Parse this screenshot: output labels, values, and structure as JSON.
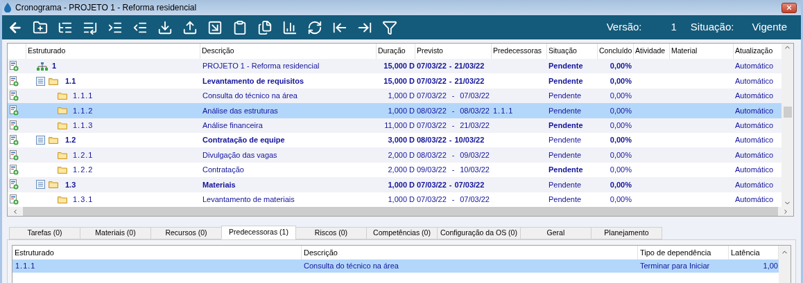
{
  "window": {
    "title": "Cronograma - PROJETO 1 - Reforma residencial"
  },
  "toolbar": {
    "version_label": "Versão:",
    "version": "1",
    "status_label": "Situação:",
    "status": "Vigente"
  },
  "schedule": {
    "columns": [
      "Estruturado",
      "Descrição",
      "Duração",
      "Previsto",
      "Predecessoras",
      "Situação",
      "Concluído",
      "Atividade",
      "Material",
      "Atualização"
    ],
    "rows": [
      {
        "kind": "project",
        "code": "1",
        "description": "PROJETO 1 - Reforma residencial",
        "duration": "15,000 D",
        "start": "07/03/22",
        "separator": "-",
        "end": "21/03/22",
        "status": "Pendente",
        "status_bold": true,
        "done": "0,00%",
        "update": "Automático",
        "selected": false
      },
      {
        "kind": "group",
        "code": "1.1",
        "description": "Levantamento de requisitos",
        "duration": "15,000 D",
        "start": "07/03/22",
        "separator": "-",
        "end": "21/03/22",
        "status": "Pendente",
        "status_bold": true,
        "done": "0,00%",
        "update": "Automático",
        "selected": false
      },
      {
        "kind": "task",
        "code": "1.1.1",
        "description": "Consulta do técnico na área",
        "duration": "1,000 D",
        "start": "07/03/22",
        "separator": "-",
        "end": "07/03/22",
        "status": "Pendente",
        "status_bold": false,
        "done": "0,00%",
        "update": "Automático",
        "selected": false
      },
      {
        "kind": "task",
        "code": "1.1.2",
        "description": "Análise das estruturas",
        "duration": "1,000 D",
        "start": "08/03/22",
        "separator": "-",
        "end": "08/03/22",
        "predecessors": "1.1.1",
        "status": "Pendente",
        "status_bold": false,
        "done": "0,00%",
        "update": "Automático",
        "selected": true
      },
      {
        "kind": "task",
        "code": "1.1.3",
        "description": "Análise financeira",
        "duration": "11,000 D",
        "start": "07/03/22",
        "separator": "-",
        "end": "21/03/22",
        "status": "Pendente",
        "status_bold": true,
        "done": "0,00%",
        "update": "Automático",
        "selected": false
      },
      {
        "kind": "group",
        "code": "1.2",
        "description": "Contratação de equipe",
        "duration": "3,000 D",
        "start": "08/03/22",
        "separator": "-",
        "end": "10/03/22",
        "status": "Pendente",
        "status_bold": false,
        "done": "0,00%",
        "update": "Automático",
        "selected": false
      },
      {
        "kind": "task",
        "code": "1.2.1",
        "description": "Divulgação das vagas",
        "duration": "2,000 D",
        "start": "08/03/22",
        "separator": "-",
        "end": "09/03/22",
        "status": "Pendente",
        "status_bold": false,
        "done": "0,00%",
        "update": "Automático",
        "selected": false
      },
      {
        "kind": "task",
        "code": "1.2.2",
        "description": "Contratação",
        "duration": "2,000 D",
        "start": "09/03/22",
        "separator": "-",
        "end": "10/03/22",
        "status": "Pendente",
        "status_bold": true,
        "done": "0,00%",
        "update": "Automático",
        "selected": false
      },
      {
        "kind": "group",
        "code": "1.3",
        "description": "Materiais",
        "duration": "1,000 D",
        "start": "07/03/22",
        "separator": "-",
        "end": "07/03/22",
        "status": "Pendente",
        "status_bold": false,
        "done": "0,00%",
        "update": "Automático",
        "selected": false
      },
      {
        "kind": "task",
        "code": "1.3.1",
        "description": "Levantamento de materiais",
        "duration": "1,000 D",
        "start": "07/03/22",
        "separator": "-",
        "end": "07/03/22",
        "status": "Pendente",
        "status_bold": false,
        "done": "0,00%",
        "update": "Automático",
        "selected": false
      }
    ]
  },
  "detail_tabs": [
    {
      "label": "Tarefas (0)",
      "selected": false
    },
    {
      "label": "Materiais (0)",
      "selected": false
    },
    {
      "label": "Recursos (0)",
      "selected": false
    },
    {
      "label": "Predecessoras (1)",
      "selected": true
    },
    {
      "label": "Riscos (0)",
      "selected": false
    },
    {
      "label": "Competências (0)",
      "selected": false
    },
    {
      "label": "Configuração da OS (0)",
      "selected": false
    },
    {
      "label": "Geral",
      "selected": false
    },
    {
      "label": "Planejamento",
      "selected": false
    }
  ],
  "predecessors": {
    "columns": [
      "Estruturado",
      "Descrição",
      "Tipo de dependência",
      "Latência"
    ],
    "rows": [
      {
        "code": "1.1.1",
        "description": "Consulta do técnico na área",
        "dependency": "Terminar para Iniciar",
        "latency": "1,00",
        "selected": true
      }
    ]
  }
}
